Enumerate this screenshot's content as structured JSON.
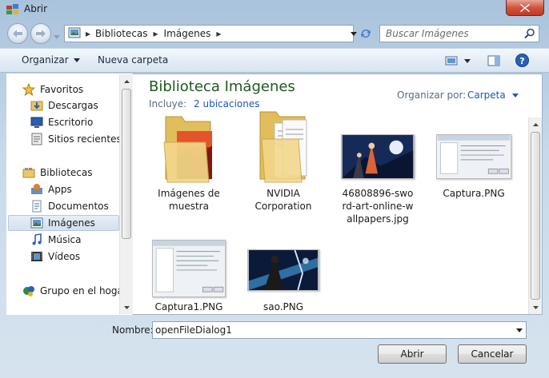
{
  "window": {
    "title": "Abrir",
    "close_icon": "close-x-icon"
  },
  "address": {
    "crumbs": [
      "Bibliotecas",
      "Imágenes"
    ],
    "separator": "▸"
  },
  "search": {
    "placeholder": "Buscar Imágenes"
  },
  "toolbar": {
    "organize_label": "Organizar",
    "new_folder_label": "Nueva carpeta"
  },
  "nav": {
    "favorites_header": "Favoritos",
    "favorites": [
      "Descargas",
      "Escritorio",
      "Sitios recientes"
    ],
    "libraries_header": "Bibliotecas",
    "libraries": [
      "Apps",
      "Documentos",
      "Imágenes",
      "Música",
      "Vídeos"
    ],
    "homegroup": "Grupo en el hogar",
    "selected": "Imágenes"
  },
  "content": {
    "title": "Biblioteca Imágenes",
    "includes_prefix": "Incluye:",
    "includes_link": "2 ubicaciones",
    "arrange_label": "Organizar por:",
    "arrange_value": "Carpeta"
  },
  "items": [
    {
      "label": "Imágenes de muestra",
      "kind": "folder-photo"
    },
    {
      "label": "NVIDIA Corporation",
      "kind": "folder-docs"
    },
    {
      "label": "46808896-sword-art-online-wallpapers.jpg",
      "kind": "wallpaper"
    },
    {
      "label": "Captura.PNG",
      "kind": "screenshot"
    },
    {
      "label": "Captura1.PNG",
      "kind": "screenshot"
    },
    {
      "label": "sao.PNG",
      "kind": "anime"
    }
  ],
  "bottom": {
    "name_label": "Nombre:",
    "name_value": "openFileDialog1",
    "open_label": "Abrir",
    "cancel_label": "Cancelar"
  },
  "colors": {
    "accent_link": "#1a58b8",
    "title_green": "#1e5a1e",
    "close_red": "#c13a22"
  }
}
